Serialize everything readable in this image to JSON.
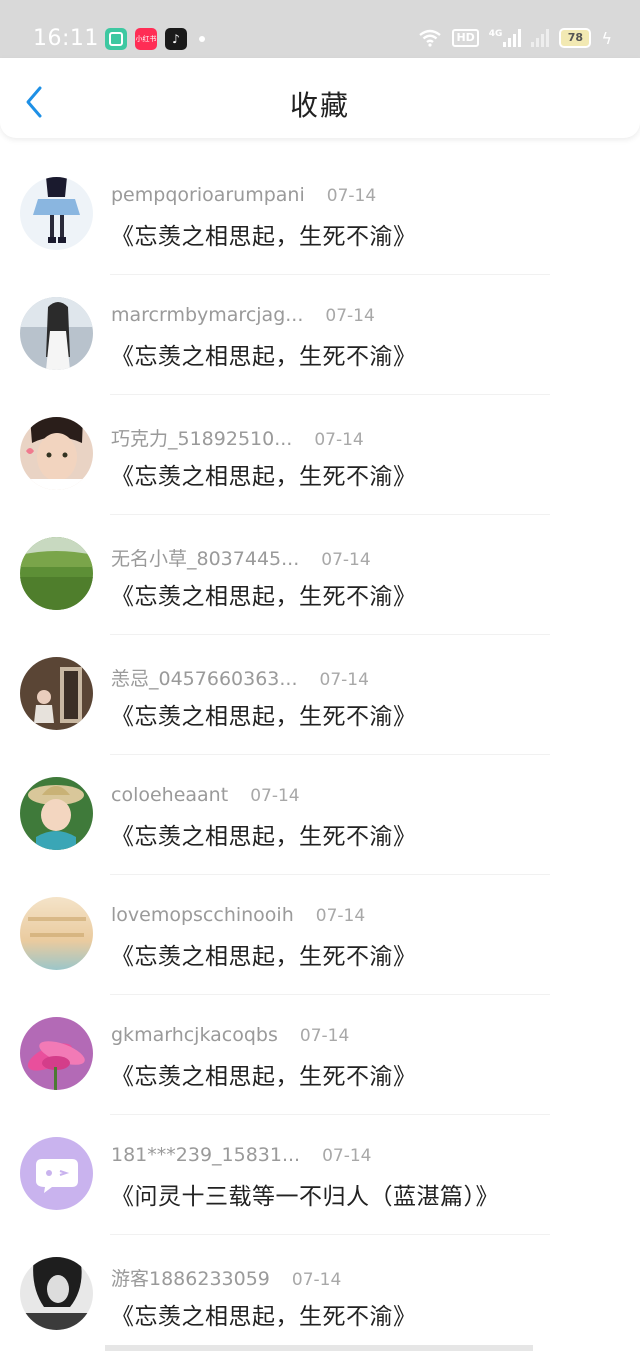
{
  "status": {
    "time": "16:11",
    "app_icon_labels": [
      "",
      "小红书",
      "♪"
    ],
    "hd": "HD",
    "network": "4G",
    "battery": "78"
  },
  "header": {
    "title": "收藏"
  },
  "items": [
    {
      "user": "pempqorioarumpani",
      "date": "07-14",
      "title": "《忘羡之相思起，生死不渝》",
      "avatar": "avatar-1"
    },
    {
      "user": "marcrmbymarcjag...",
      "date": "07-14",
      "title": "《忘羡之相思起，生死不渝》",
      "avatar": "avatar-2"
    },
    {
      "user": "巧克力_51892510...",
      "date": "07-14",
      "title": "《忘羡之相思起，生死不渝》",
      "avatar": "avatar-3"
    },
    {
      "user": "无名小草_8037445...",
      "date": "07-14",
      "title": "《忘羡之相思起，生死不渝》",
      "avatar": "avatar-4"
    },
    {
      "user": "恙忌_0457660363...",
      "date": "07-14",
      "title": "《忘羡之相思起，生死不渝》",
      "avatar": "avatar-5"
    },
    {
      "user": "coloeheaant",
      "date": "07-14",
      "title": "《忘羡之相思起，生死不渝》",
      "avatar": "avatar-6"
    },
    {
      "user": "lovemopscchinooih",
      "date": "07-14",
      "title": "《忘羡之相思起，生死不渝》",
      "avatar": "avatar-7"
    },
    {
      "user": "gkmarhcjkacoqbs",
      "date": "07-14",
      "title": "《忘羡之相思起，生死不渝》",
      "avatar": "avatar-8"
    },
    {
      "user": "181***239_15831...",
      "date": "07-14",
      "title": "《问灵十三载等一不归人（蓝湛篇）》",
      "avatar": "avatar-9"
    },
    {
      "user": "游客1886233059",
      "date": "07-14",
      "title": "《忘羡之相思起，生死不渝》",
      "avatar": "avatar-10"
    }
  ],
  "colors": {
    "accent": "#1e90e6",
    "status_bar": "#d9d9d9",
    "meta_text": "#9a9a9a",
    "title_text": "#222222"
  }
}
